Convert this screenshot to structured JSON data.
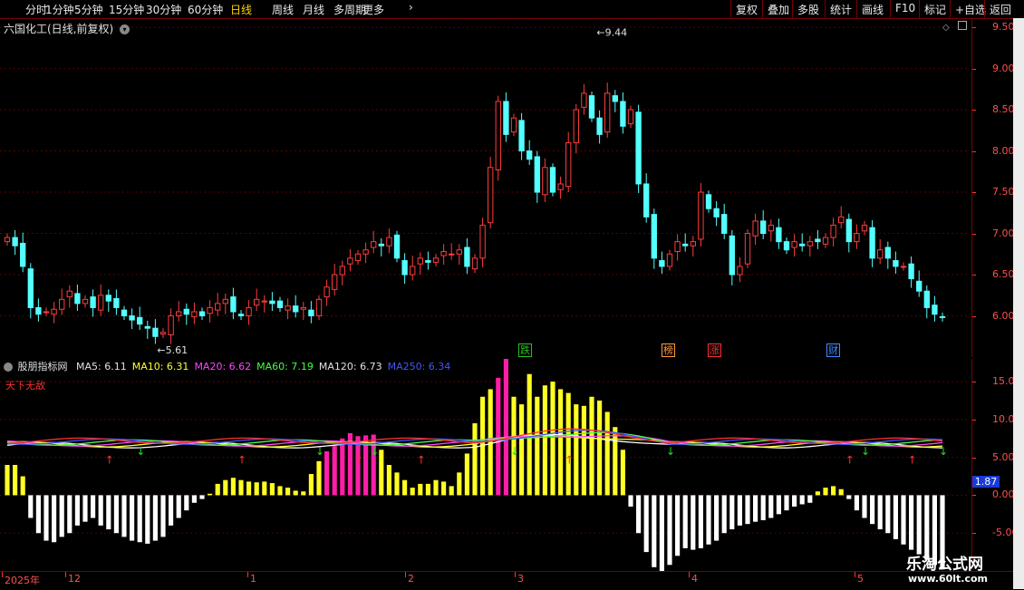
{
  "toolbar": {
    "left": [
      "分时",
      "1分钟",
      "5分钟",
      "15分钟",
      "30分钟",
      "60分钟",
      "日线",
      "周线",
      "月线",
      "多周期",
      "更多"
    ],
    "active_index": 6,
    "right": [
      "复权",
      "叠加",
      "多股",
      "统计",
      "画线",
      "F10",
      "标记",
      "+自选",
      "返回"
    ]
  },
  "main_chart": {
    "title": "六国化工(日线,前复权)",
    "y_ticks": [
      "9.50",
      "9.00",
      "8.50",
      "8.00",
      "7.50",
      "7.00",
      "6.50",
      "6.00"
    ],
    "high_label": "9.44",
    "low_label": "5.61",
    "event_markers": [
      {
        "text": "跌",
        "color": "#22c422"
      },
      {
        "text": "榜",
        "color": "#ff9a3c"
      },
      {
        "text": "涨",
        "color": "#ff3030"
      },
      {
        "text": "财",
        "color": "#3a8cff"
      }
    ]
  },
  "indicator": {
    "name": "股朋指标网",
    "ma_legend": [
      {
        "label": "MA5: 6.11",
        "color": "#e0e0e0"
      },
      {
        "label": "MA10: 6.31",
        "color": "#ffff33"
      },
      {
        "label": "MA20: 6.62",
        "color": "#ff44ff"
      },
      {
        "label": "MA60: 7.19",
        "color": "#44ff44"
      },
      {
        "label": "MA120: 6.73",
        "color": "#e0e0e0"
      },
      {
        "label": "MA250: 6.34",
        "color": "#4455ff"
      }
    ],
    "subtitle": "天下无敌",
    "y_ticks": [
      "15.00",
      "10.00",
      "5.00",
      "0.00",
      "-5.00"
    ],
    "current_value": "1.87"
  },
  "date_axis": {
    "labels": [
      "2025年",
      "12",
      "1",
      "2",
      "3",
      "4",
      "5"
    ]
  },
  "watermark": {
    "title": "乐淘公式网",
    "url": "www.60lt.com"
  },
  "chart_data": [
    {
      "type": "candlestick",
      "title": "六国化工(日线,前复权)",
      "ylim": [
        5.5,
        9.6
      ],
      "high": 9.44,
      "low": 5.61,
      "closes": [
        6.95,
        6.85,
        6.6,
        6.1,
        6.02,
        6.05,
        6.08,
        6.2,
        6.3,
        6.15,
        6.2,
        6.1,
        6.25,
        6.18,
        6.1,
        6.0,
        5.95,
        5.9,
        5.85,
        5.75,
        5.8,
        6.0,
        6.05,
        6.02,
        6.05,
        6.0,
        6.1,
        6.15,
        6.2,
        6.05,
        6.0,
        6.1,
        6.2,
        6.18,
        6.15,
        6.1,
        6.12,
        6.05,
        6.1,
        6.0,
        6.2,
        6.35,
        6.5,
        6.6,
        6.7,
        6.75,
        6.8,
        6.9,
        6.85,
        6.95,
        6.7,
        6.5,
        6.6,
        6.7,
        6.65,
        6.7,
        6.78,
        6.75,
        6.8,
        6.6,
        6.7,
        7.1,
        7.8,
        8.6,
        8.2,
        8.4,
        8.0,
        7.9,
        7.5,
        7.8,
        7.5,
        7.6,
        8.1,
        8.5,
        8.7,
        8.4,
        8.2,
        8.7,
        8.6,
        8.3,
        8.5,
        7.6,
        7.2,
        6.7,
        6.6,
        6.75,
        6.9,
        6.85,
        6.9,
        7.5,
        7.3,
        7.2,
        7.0,
        6.5,
        6.6,
        7.0,
        7.15,
        7.0,
        7.1,
        6.9,
        6.8,
        6.9,
        6.85,
        6.9,
        6.9,
        6.95,
        7.1,
        7.2,
        6.9,
        7.0,
        7.1,
        6.7,
        6.8,
        6.7,
        6.6,
        6.6,
        6.45,
        6.3,
        6.1,
        6.02,
        5.98
      ]
    },
    {
      "type": "bar",
      "title": "股朋指标网",
      "ylim": [
        -10,
        18
      ],
      "values": [
        4,
        4,
        2.5,
        -3,
        -5,
        -6,
        -6.2,
        -5.5,
        -5,
        -4,
        -3.5,
        -3,
        -4,
        -4.5,
        -5,
        -5.5,
        -6,
        -6.2,
        -6.4,
        -6,
        -5.5,
        -4,
        -3,
        -2,
        -1,
        -0.5,
        0.2,
        1.5,
        2,
        2.3,
        2,
        1.8,
        1.7,
        1.8,
        1.6,
        1.2,
        1.0,
        0.6,
        0.5,
        2.8,
        4.5,
        5.8,
        6.5,
        7.5,
        8.2,
        7.8,
        7.9,
        8.0,
        6.0,
        4.0,
        3.0,
        2.0,
        1.0,
        1.5,
        1.5,
        2.0,
        1.8,
        1.2,
        3.0,
        5.5,
        9.5,
        13,
        14,
        15.5,
        18,
        13,
        12,
        16,
        13,
        14.5,
        15,
        14,
        13.5,
        12,
        11.8,
        13,
        12.5,
        11,
        9,
        6,
        -1.5,
        -5,
        -7.5,
        -9.5,
        -10.2,
        -9.2,
        -8,
        -7,
        -7.2,
        -7,
        -6.5,
        -6,
        -5,
        -4.5,
        -4,
        -3.8,
        -3.5,
        -3.3,
        -3,
        -2.5,
        -2,
        -1.5,
        -1.2,
        -1,
        0.5,
        1,
        1.2,
        0.8,
        -0.5,
        -2,
        -3,
        -3.8,
        -4.5,
        -5,
        -5.8,
        -6.5,
        -7.2,
        -7.8,
        -8.5,
        -9.2,
        -9.8
      ]
    }
  ]
}
